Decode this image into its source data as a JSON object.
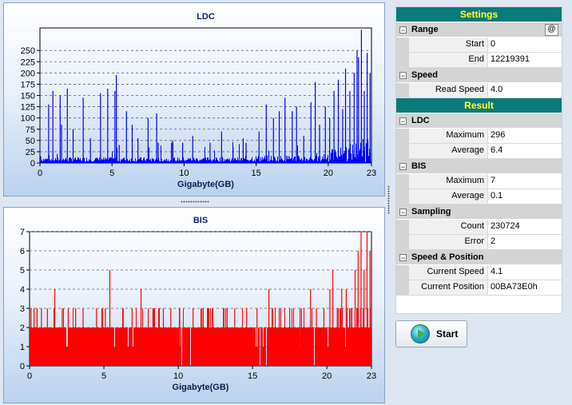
{
  "charts": {
    "ldc": {
      "title": "LDC",
      "xlabel": "Gigabyte(GB)"
    },
    "bis": {
      "title": "BIS",
      "xlabel": "Gigabyte(GB)"
    }
  },
  "chart_data": [
    {
      "type": "bar",
      "title": "LDC",
      "xlabel": "Gigabyte(GB)",
      "ylabel": "",
      "xlim": [
        0,
        23
      ],
      "ylim": [
        0,
        300
      ],
      "x_ticks": [
        0,
        5,
        10,
        15,
        20,
        23
      ],
      "y_ticks": [
        0,
        25,
        50,
        75,
        100,
        125,
        150,
        175,
        200,
        225,
        250
      ],
      "y_tick_labels": [
        "0",
        "25",
        "50",
        "75",
        "100",
        "125",
        "150",
        "175",
        "200",
        "225",
        "250"
      ],
      "grid": true,
      "color": "#0000ff",
      "x": [
        0.05,
        0.6,
        0.9,
        1.2,
        1.4,
        1.5,
        1.9,
        2.3,
        3.0,
        3.5,
        4.2,
        4.7,
        5.2,
        5.3,
        5.5,
        6.0,
        6.4,
        6.8,
        7.5,
        8.1,
        8.2,
        9.2,
        9.9,
        10.6,
        11.8,
        12.6,
        13.4,
        14.1,
        14.3,
        15.2,
        15.7,
        16.2,
        16.6,
        17.0,
        17.5,
        17.8,
        18.3,
        18.8,
        19.1,
        19.4,
        19.8,
        20.1,
        20.4,
        20.7,
        21.0,
        21.2,
        21.5,
        21.8,
        22.0,
        22.1,
        22.3,
        22.5,
        22.7,
        22.9
      ],
      "values": [
        15,
        130,
        160,
        20,
        150,
        85,
        165,
        75,
        145,
        55,
        155,
        165,
        160,
        195,
        40,
        115,
        85,
        55,
        100,
        110,
        45,
        50,
        45,
        60,
        45,
        70,
        35,
        55,
        45,
        70,
        130,
        100,
        115,
        145,
        115,
        125,
        60,
        135,
        180,
        85,
        125,
        100,
        160,
        185,
        120,
        210,
        160,
        200,
        250,
        235,
        296,
        160,
        245,
        200
      ],
      "baseline_noise_average": 6.4
    },
    {
      "type": "bar",
      "title": "BIS",
      "xlabel": "Gigabyte(GB)",
      "ylabel": "",
      "xlim": [
        0,
        23
      ],
      "ylim": [
        0,
        7
      ],
      "x_ticks": [
        0,
        5,
        10,
        15,
        20,
        23
      ],
      "y_ticks": [
        0,
        1,
        2,
        3,
        4,
        5,
        6,
        7
      ],
      "grid": true,
      "color": "#ff0000",
      "x": [
        0.1,
        0.3,
        0.5,
        0.8,
        1.2,
        1.7,
        2.2,
        2.6,
        3.1,
        3.6,
        4.5,
        5.1,
        5.4,
        6.3,
        6.9,
        7.5,
        8.3,
        9.0,
        9.5,
        10.1,
        11.0,
        11.6,
        12.3,
        13.2,
        13.8,
        14.6,
        15.3,
        16.1,
        16.8,
        17.5,
        18.2,
        18.9,
        19.3,
        19.8,
        20.2,
        20.4,
        20.7,
        21.0,
        21.3,
        21.6,
        21.9,
        22.1,
        22.3,
        22.5,
        22.7,
        22.9
      ],
      "values": [
        3,
        3,
        3,
        3,
        3,
        4,
        3,
        3,
        3,
        3,
        3,
        3,
        5,
        3,
        3,
        4,
        3,
        3,
        3,
        3,
        3,
        3,
        3,
        3,
        3,
        3,
        3,
        4,
        3,
        3,
        3,
        4,
        3,
        3,
        4,
        5,
        3,
        4,
        4,
        3,
        5,
        6,
        7,
        5,
        7,
        6
      ],
      "baseline_level": 2
    }
  ],
  "settings": {
    "header": "Settings",
    "range": {
      "label": "Range",
      "at_button": "@",
      "start_label": "Start",
      "start_value": "0",
      "end_label": "End",
      "end_value": "12219391"
    },
    "speed": {
      "label": "Speed",
      "read_speed_label": "Read Speed",
      "read_speed_value": "4.0"
    }
  },
  "result": {
    "header": "Result",
    "ldc": {
      "label": "LDC",
      "max_label": "Maximum",
      "max_value": "296",
      "avg_label": "Average",
      "avg_value": "6.4"
    },
    "bis": {
      "label": "BIS",
      "max_label": "Maximum",
      "max_value": "7",
      "avg_label": "Average",
      "avg_value": "0.1"
    },
    "sampling": {
      "label": "Sampling",
      "count_label": "Count",
      "count_value": "230724",
      "error_label": "Error",
      "error_value": "2"
    },
    "speed_position": {
      "label": "Speed & Position",
      "current_speed_label": "Current Speed",
      "current_speed_value": "4.1",
      "current_position_label": "Current Position",
      "current_position_value": "00BA73E0h"
    }
  },
  "start_button": {
    "label": "Start"
  },
  "colors": {
    "ldc_series": "#0000ff",
    "bis_series": "#ff0000",
    "header_bg": "#0b7a7a",
    "header_text": "#ffff33"
  }
}
